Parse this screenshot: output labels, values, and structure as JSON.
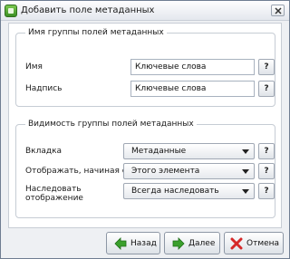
{
  "window": {
    "title": "Добавить поле метаданных"
  },
  "group_name": {
    "legend": "Имя группы полей метаданных",
    "name_label": "Имя",
    "name_value": "Ключевые слова",
    "caption_label": "Надпись",
    "caption_value": "Ключевые слова",
    "help_label": "?"
  },
  "visibility": {
    "legend": "Видимость группы полей метаданных",
    "tab_label": "Вкладка",
    "tab_value": "Метаданные",
    "display_from_label": "Отображать, начиная с",
    "display_from_value": "Этого элемента",
    "inherit_label_line1": "Наследовать",
    "inherit_label_line2": "отображение",
    "inherit_value": "Всегда наследовать",
    "help_label": "?"
  },
  "buttons": {
    "back": "Назад",
    "next": "Далее",
    "cancel": "Отмена"
  },
  "colors": {
    "arrow_green": "#3aa02c",
    "cancel_red": "#d62828"
  }
}
